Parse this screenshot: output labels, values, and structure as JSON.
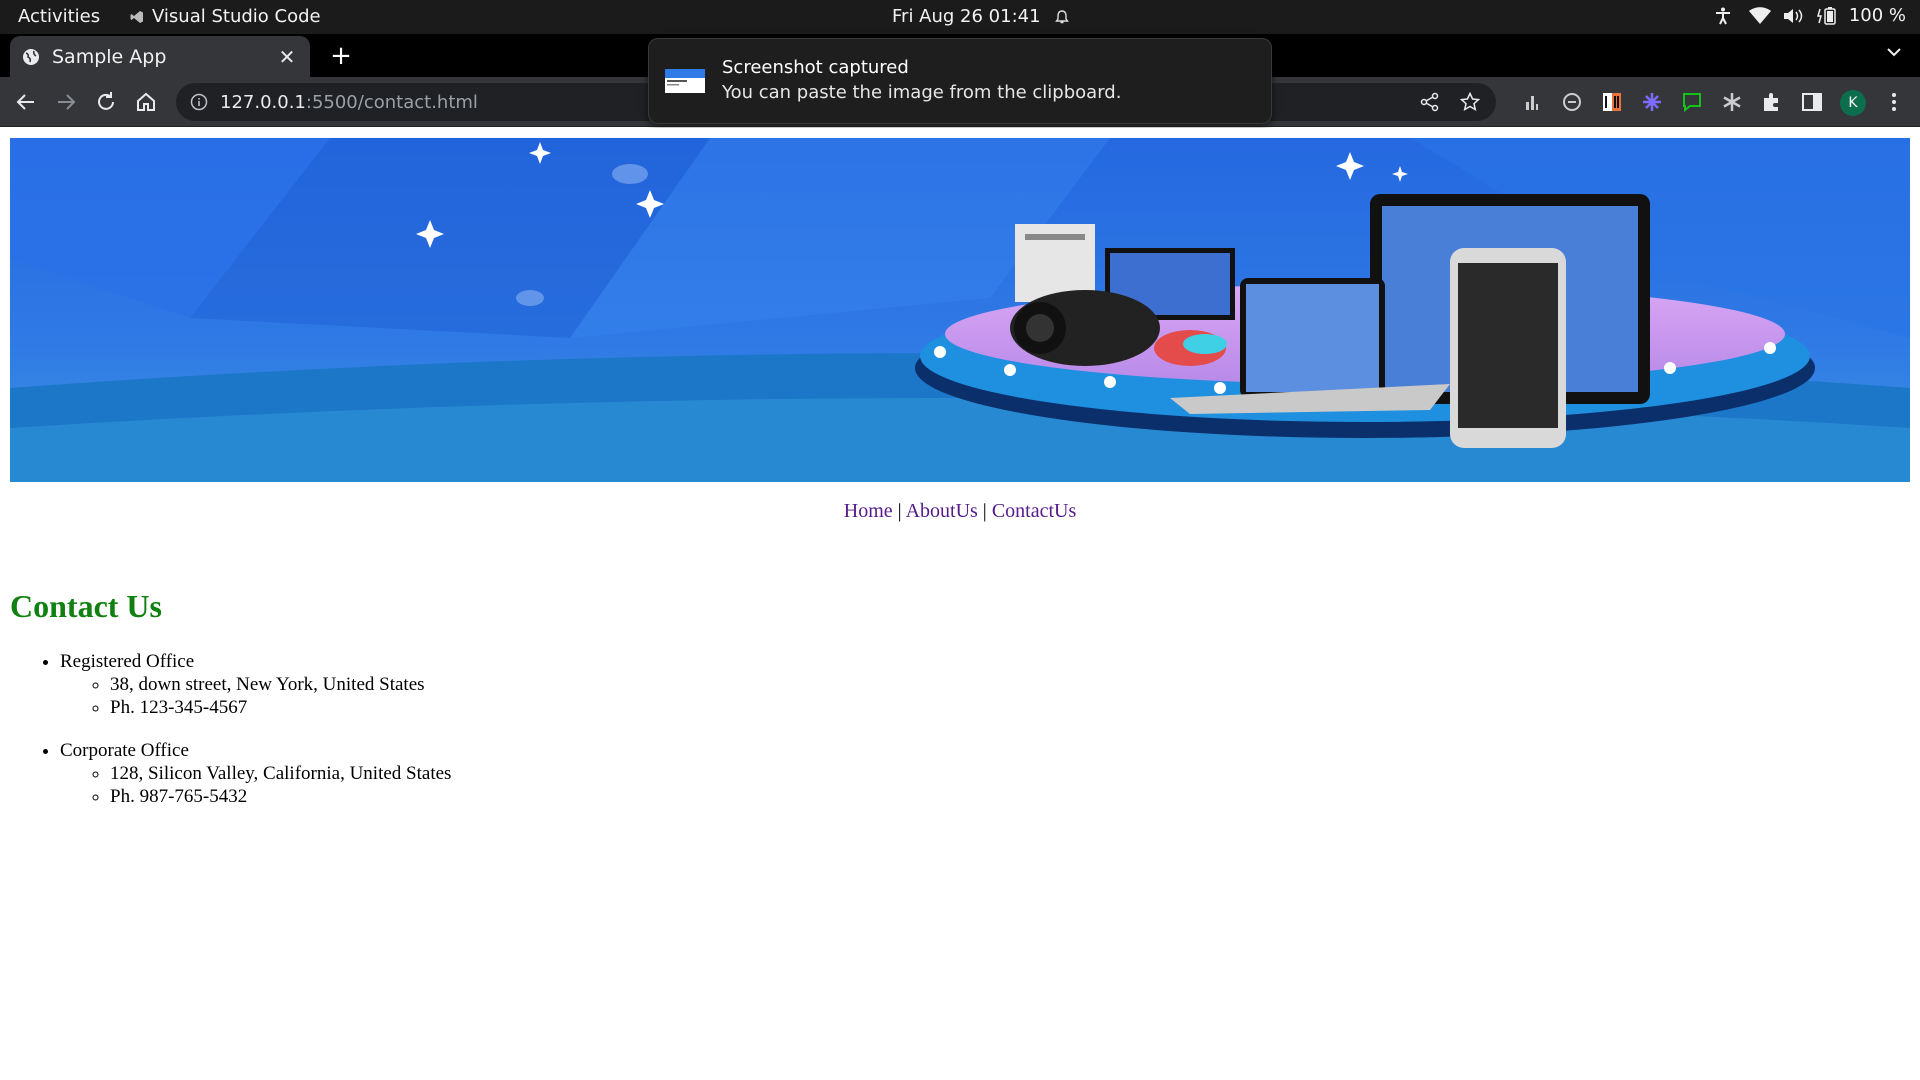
{
  "topbar": {
    "activities": "Activities",
    "app_name": "Visual Studio Code",
    "datetime": "Fri Aug 26  01:41",
    "battery": "100 %"
  },
  "browser": {
    "tab_title": "Sample App",
    "url_host": "127.0.0.1",
    "url_rest": ":5500/contact.html",
    "profile_initial": "K"
  },
  "notification": {
    "title": "Screenshot captured",
    "body": "You can paste the image from the clipboard."
  },
  "page": {
    "nav": {
      "home": "Home",
      "about": "AboutUs",
      "contact": "ContactUs",
      "separator": "|"
    },
    "title": "Contact Us",
    "offices": [
      {
        "name": "Registered Office",
        "address": "38, down street, New York, United States",
        "phone": "Ph. 123-345-4567"
      },
      {
        "name": "Corporate Office",
        "address": "128, Silicon Valley, California, United States",
        "phone": "Ph. 987-765-5432"
      }
    ]
  },
  "colors": {
    "banner_blue": "#2f7ae5",
    "heading_green": "#108010",
    "link_purple": "#551a8b",
    "browser_dark": "#35363a"
  }
}
